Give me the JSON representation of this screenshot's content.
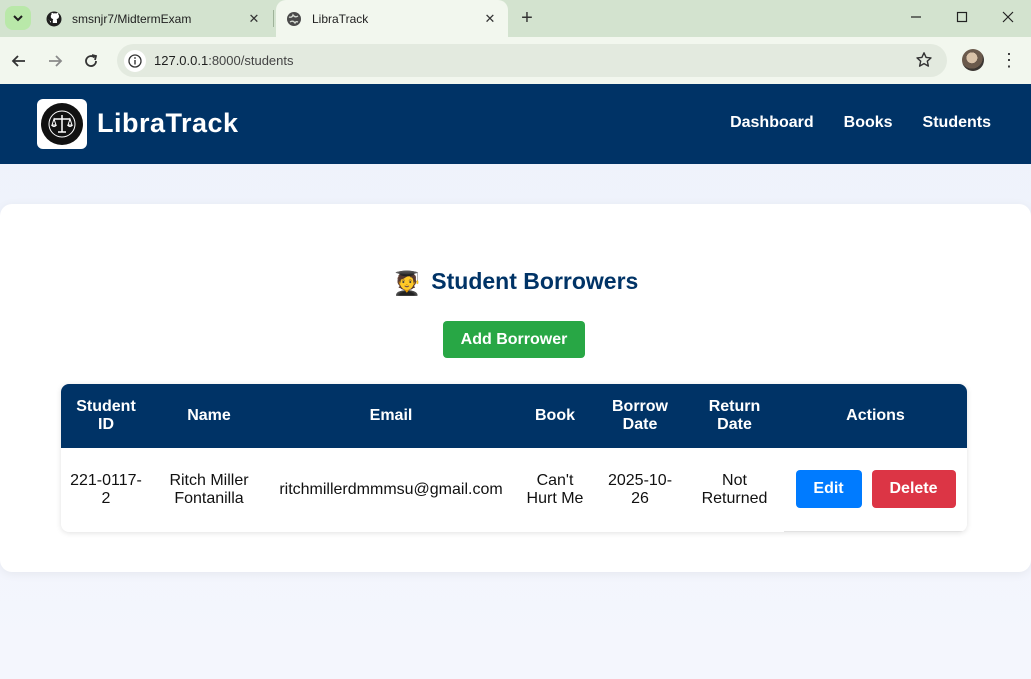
{
  "browser": {
    "tabs": [
      {
        "title": "smsnjr7/MidtermExam",
        "icon": "github-icon",
        "active": false
      },
      {
        "title": "LibraTrack",
        "icon": "globe-icon",
        "active": true
      }
    ],
    "url_host": "127.0.0.1",
    "url_path": ":8000/students"
  },
  "navbar": {
    "brand": "LibraTrack",
    "links": [
      "Dashboard",
      "Books",
      "Students"
    ],
    "color": "#003366"
  },
  "main": {
    "heading": "Student Borrowers",
    "heading_emoji": "🧑‍🎓",
    "add_button": "Add Borrower",
    "table": {
      "headers": [
        "Student ID",
        "Name",
        "Email",
        "Book",
        "Borrow Date",
        "Return Date",
        "Actions"
      ],
      "rows": [
        {
          "student_id": "221-0117-2",
          "name": "Ritch Miller Fontanilla",
          "email": "ritchmillerdmmmsu@gmail.com",
          "book": "Can't Hurt Me",
          "borrow_date": "2025-10-26",
          "return_date": "Not Returned",
          "edit_label": "Edit",
          "delete_label": "Delete"
        }
      ]
    }
  },
  "colors": {
    "add": "#28a745",
    "edit": "#007bff",
    "delete": "#dc3545"
  }
}
